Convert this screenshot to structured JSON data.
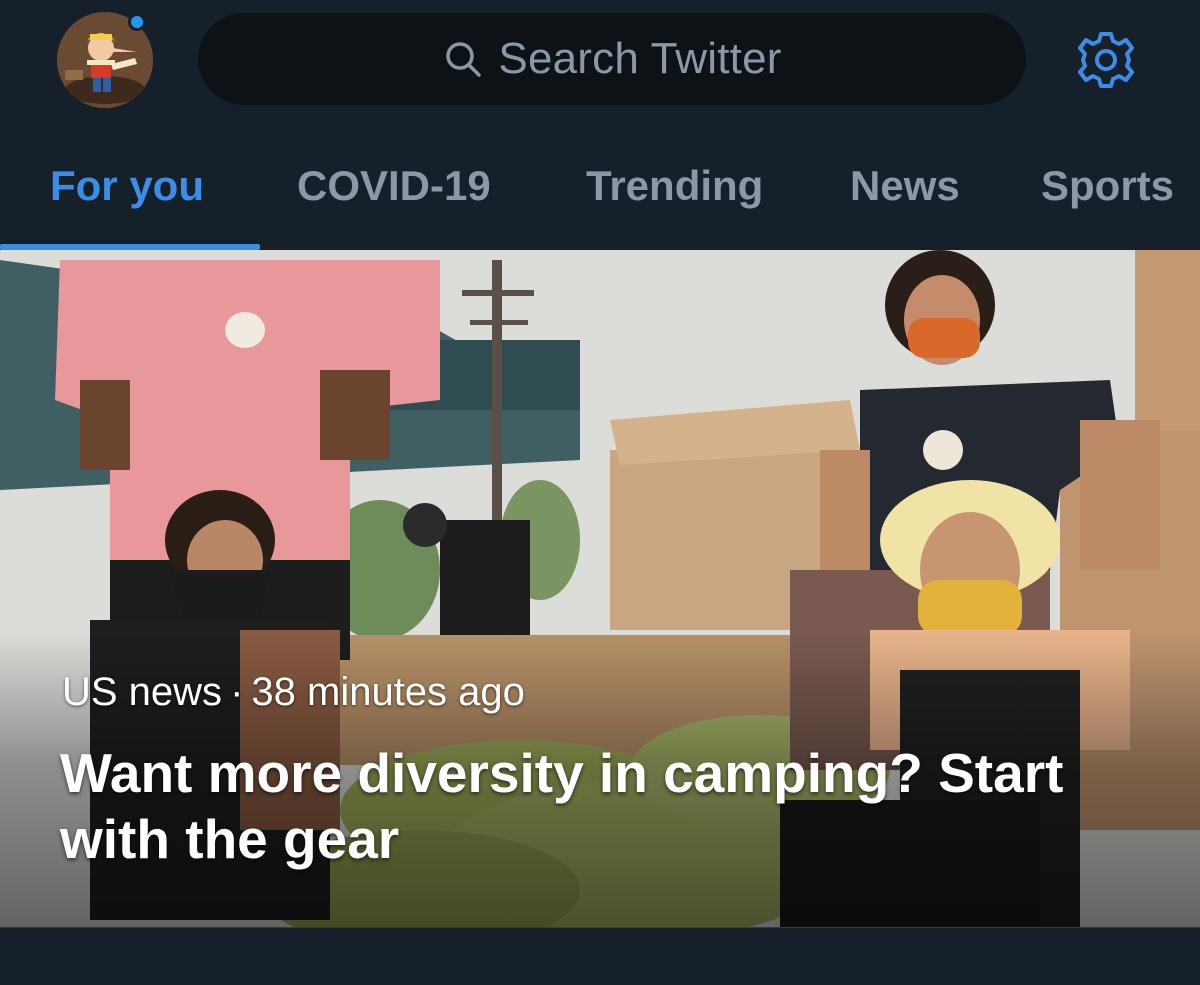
{
  "header": {
    "search_placeholder": "Search Twitter",
    "notification_dot_color": "#1d9bf0",
    "avatar_icon": "profile-avatar",
    "search_icon": "search-icon",
    "settings_icon": "gear-icon",
    "accent_color": "#1d9bf0"
  },
  "tabs": [
    {
      "label": "For you",
      "active": true
    },
    {
      "label": "COVID-19",
      "active": false
    },
    {
      "label": "Trending",
      "active": false
    },
    {
      "label": "News",
      "active": false
    },
    {
      "label": "Sports",
      "active": false
    }
  ],
  "story": {
    "category": "US news",
    "separator": "·",
    "time": "38 minutes ago",
    "headline": "Want more diversity in camping? Start with the gear"
  }
}
